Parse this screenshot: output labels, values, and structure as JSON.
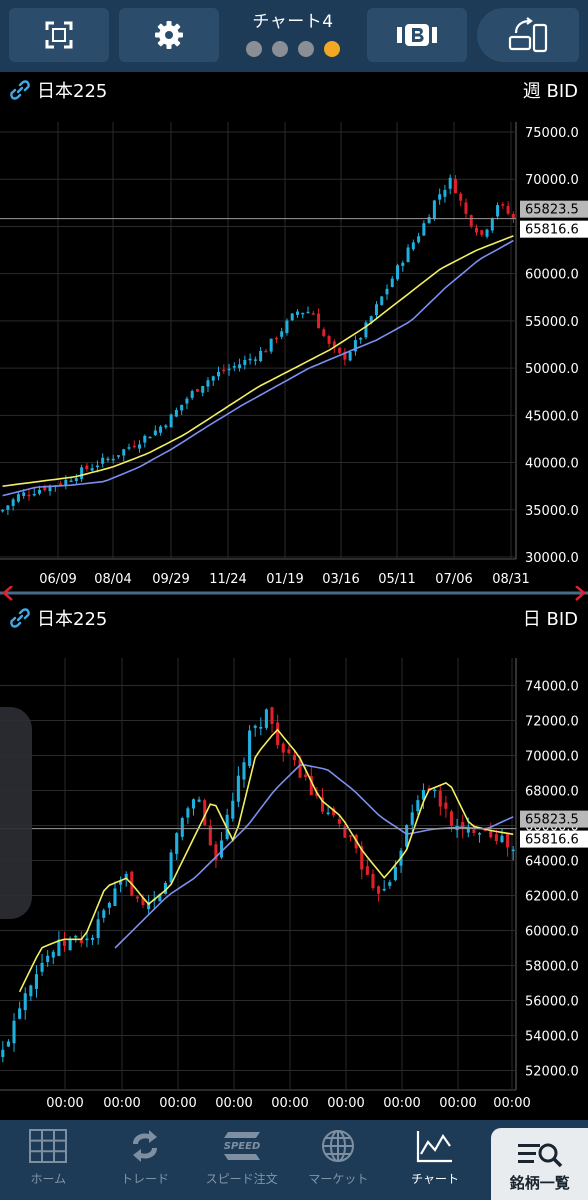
{
  "header": {
    "title": "チャート4",
    "page_count": 4,
    "active_page": 4
  },
  "charts": {
    "top": {
      "symbol": "日本225",
      "timeframe": "週 BID",
      "y_ticks": [
        "75000.0",
        "70000.0",
        "65000.0",
        "60000.0",
        "55000.0",
        "50000.0",
        "45000.0",
        "40000.0",
        "35000.0",
        "30000.0"
      ],
      "x_ticks": [
        "06/09",
        "08/04",
        "09/29",
        "11/24",
        "01/19",
        "03/16",
        "05/11",
        "07/06",
        "08/31"
      ],
      "price_label_upper": "65823.5",
      "price_label_lower": "65816.6"
    },
    "bottom": {
      "symbol": "日本225",
      "timeframe": "日 BID",
      "y_ticks": [
        "74000.0",
        "72000.0",
        "70000.0",
        "68000.0",
        "66000.0",
        "64000.0",
        "62000.0",
        "60000.0",
        "58000.0",
        "56000.0",
        "54000.0",
        "52000.0"
      ],
      "x_ticks": [
        "00:00",
        "00:00",
        "00:00",
        "00:00",
        "00:00",
        "00:00",
        "00:00",
        "00:00",
        "00:00"
      ],
      "price_label_upper": "65823.5",
      "price_label_lower": "65816.6"
    }
  },
  "nav": {
    "items": [
      {
        "label": "ホーム",
        "icon": "home-grid-icon"
      },
      {
        "label": "トレード",
        "icon": "trade-cycle-icon"
      },
      {
        "label": "スピード注文",
        "icon": "speed-order-icon"
      },
      {
        "label": "マーケット",
        "icon": "market-globe-icon"
      },
      {
        "label": "チャート",
        "icon": "chart-icon"
      },
      {
        "label": "銘柄一覧",
        "icon": "symbol-list-search-icon"
      }
    ],
    "active": "チャート"
  },
  "colors": {
    "bg": "#000000",
    "topbar": "#1d3b57",
    "button": "#2b4d6b",
    "bull_candle": "#20b0e0",
    "bear_candle": "#e0202a",
    "ma_short": "#f2f060",
    "ma_long": "#7a8ff0",
    "grid": "#2a2a2a",
    "current_price_line": "#9a9a9a",
    "divider_arrow": "#e0202a",
    "page_dot_active": "#f1a823",
    "page_dot": "#8a8f96"
  },
  "chart_data": [
    {
      "type": "candlestick",
      "title": "日本225 週 BID",
      "ylim": [
        30000,
        75000
      ],
      "current_price": [
        65823.5,
        65816.6
      ],
      "series": [
        {
          "values_close": [
            35000,
            36500,
            37000,
            37500,
            38000,
            39000,
            39800,
            40500,
            41500,
            42500,
            43500,
            45000,
            47000,
            48500,
            49500,
            50200,
            51000,
            52000,
            54000,
            56000,
            56000,
            52500,
            51000,
            53000,
            56000,
            59000,
            62000,
            64500,
            68000,
            70000,
            66000,
            64000,
            67500,
            65800
          ]
        },
        {
          "values": [
            37500,
            38000,
            38500,
            39500,
            41000,
            43000,
            45500,
            48000,
            50000,
            52000,
            54500,
            57500,
            60500,
            62500,
            64000
          ]
        },
        {
          "values": [
            36500,
            37400,
            37600,
            38000,
            39500,
            41500,
            43800,
            46000,
            48000,
            50000,
            51500,
            53000,
            55000,
            58500,
            61500,
            63500
          ]
        }
      ]
    },
    {
      "type": "candlestick",
      "title": "日本225 日 BID",
      "ylim": [
        51000,
        75000
      ],
      "current_price": [
        65823.5,
        65816.6
      ],
      "series": [
        {
          "values_close": [
            53000,
            56000,
            58000,
            59000,
            59500,
            59500,
            61500,
            63000,
            61000,
            62000,
            66000,
            68000,
            64000,
            67000,
            71000,
            72500,
            70000,
            69000,
            67000,
            66000,
            65000,
            62000,
            63000,
            66000,
            68500,
            67000,
            65500,
            66000,
            65500,
            64500
          ]
        },
        {
          "values": [
            56500,
            59000,
            59500,
            59500,
            62500,
            63000,
            61500,
            62500,
            65000,
            67500,
            65000,
            70000,
            71500,
            70000,
            67500,
            66500,
            64500,
            63000,
            64500,
            68000,
            68500,
            66000,
            65700,
            65500
          ]
        },
        {
          "values": [
            59000,
            60500,
            62000,
            63000,
            64500,
            66000,
            68000,
            69500,
            69200,
            68000,
            66500,
            65500,
            65800,
            65900,
            65800,
            66500
          ]
        }
      ]
    }
  ]
}
